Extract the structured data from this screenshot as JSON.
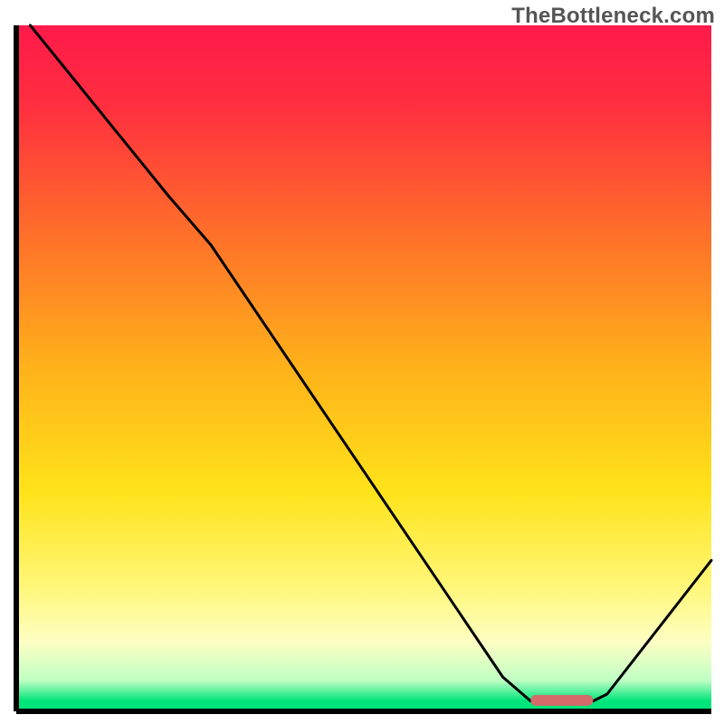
{
  "watermark": "TheBottleneck.com",
  "chart_data": {
    "type": "line",
    "title": "",
    "xlabel": "",
    "ylabel": "",
    "xlim": [
      0,
      100
    ],
    "ylim": [
      0,
      100
    ],
    "gradient_stops": [
      {
        "offset": 0.0,
        "color": "#ff1a4a"
      },
      {
        "offset": 0.12,
        "color": "#ff2f3f"
      },
      {
        "offset": 0.3,
        "color": "#ff6e2a"
      },
      {
        "offset": 0.5,
        "color": "#ffb21a"
      },
      {
        "offset": 0.68,
        "color": "#ffe31a"
      },
      {
        "offset": 0.82,
        "color": "#fff77a"
      },
      {
        "offset": 0.9,
        "color": "#fdffc4"
      },
      {
        "offset": 0.955,
        "color": "#bfffc4"
      },
      {
        "offset": 0.985,
        "color": "#00e57a"
      },
      {
        "offset": 1.0,
        "color": "#00e57a"
      }
    ],
    "curve_points": [
      {
        "x": 2.0,
        "y": 100.0
      },
      {
        "x": 22.0,
        "y": 75.0
      },
      {
        "x": 28.0,
        "y": 68.0
      },
      {
        "x": 70.0,
        "y": 5.0
      },
      {
        "x": 74.0,
        "y": 1.5
      },
      {
        "x": 83.0,
        "y": 1.5
      },
      {
        "x": 85.0,
        "y": 2.5
      },
      {
        "x": 100.0,
        "y": 22.0
      }
    ],
    "marker": {
      "x_start": 74.0,
      "x_end": 83.0,
      "y": 1.6,
      "color": "#d46a6a"
    }
  }
}
